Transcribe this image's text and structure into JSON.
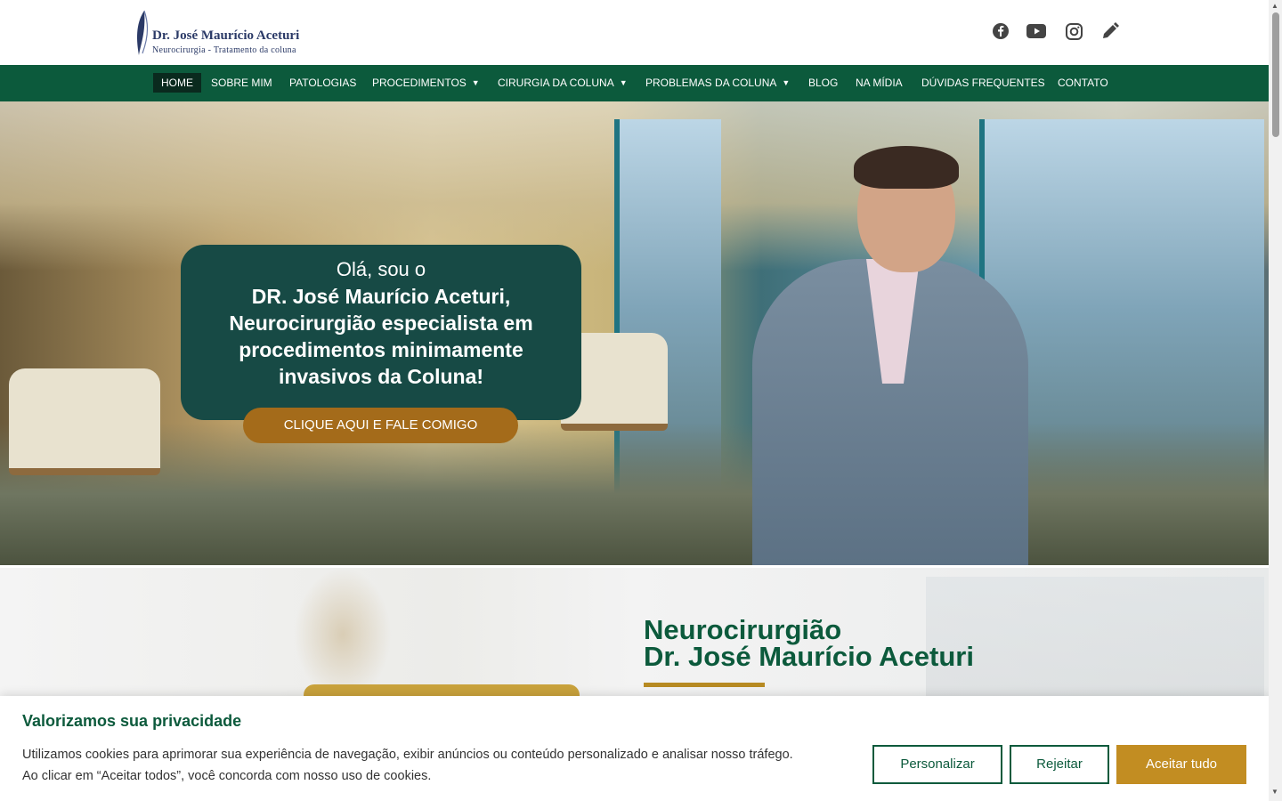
{
  "header": {
    "logo_name": "Dr. José Maurício Aceturi",
    "logo_sub": "Neurocirurgia  - Tratamento da coluna",
    "social": [
      {
        "icon": "facebook-icon"
      },
      {
        "icon": "youtube-icon"
      },
      {
        "icon": "instagram-icon"
      },
      {
        "icon": "pencil-icon"
      }
    ]
  },
  "nav": {
    "items": [
      {
        "label": "HOME",
        "active": true
      },
      {
        "label": "SOBRE MIM"
      },
      {
        "label": "PATOLOGIAS"
      },
      {
        "label": "PROCEDIMENTOS",
        "dropdown": true
      },
      {
        "label": "CIRURGIA DA COLUNA",
        "dropdown": true
      },
      {
        "label": "PROBLEMAS DA COLUNA",
        "dropdown": true
      },
      {
        "label": "BLOG"
      },
      {
        "label": "NA MÍDIA"
      },
      {
        "label": "DÚVIDAS FREQUENTES"
      },
      {
        "label": "CONTATO"
      }
    ]
  },
  "hero": {
    "hello": "Olá, sou o",
    "title_line1": "DR. José Maurício Aceturi,",
    "title_line2": "Neurocirurgião especialista em",
    "title_line3": "procedimentos minimamente",
    "title_line4": "invasivos da Coluna!",
    "cta": "CLIQUE AQUI E FALE COMIGO"
  },
  "section2": {
    "title_line1": "Neurocirurgião",
    "title_line2": "Dr. José Maurício Aceturi"
  },
  "cookie": {
    "title": "Valorizamos sua privacidade",
    "text_line1": "Utilizamos cookies para aprimorar sua experiência de navegação, exibir anúncios ou conteúdo personalizado e analisar nosso tráfego.",
    "text_line2": "Ao clicar em “Aceitar todos”, você concorda com nosso uso de cookies.",
    "customize": "Personalizar",
    "reject": "Rejeitar",
    "accept": "Aceitar tudo"
  },
  "colors": {
    "brand_green": "#0c5a3c",
    "card_teal": "#174a45",
    "gold": "#c28d22"
  }
}
